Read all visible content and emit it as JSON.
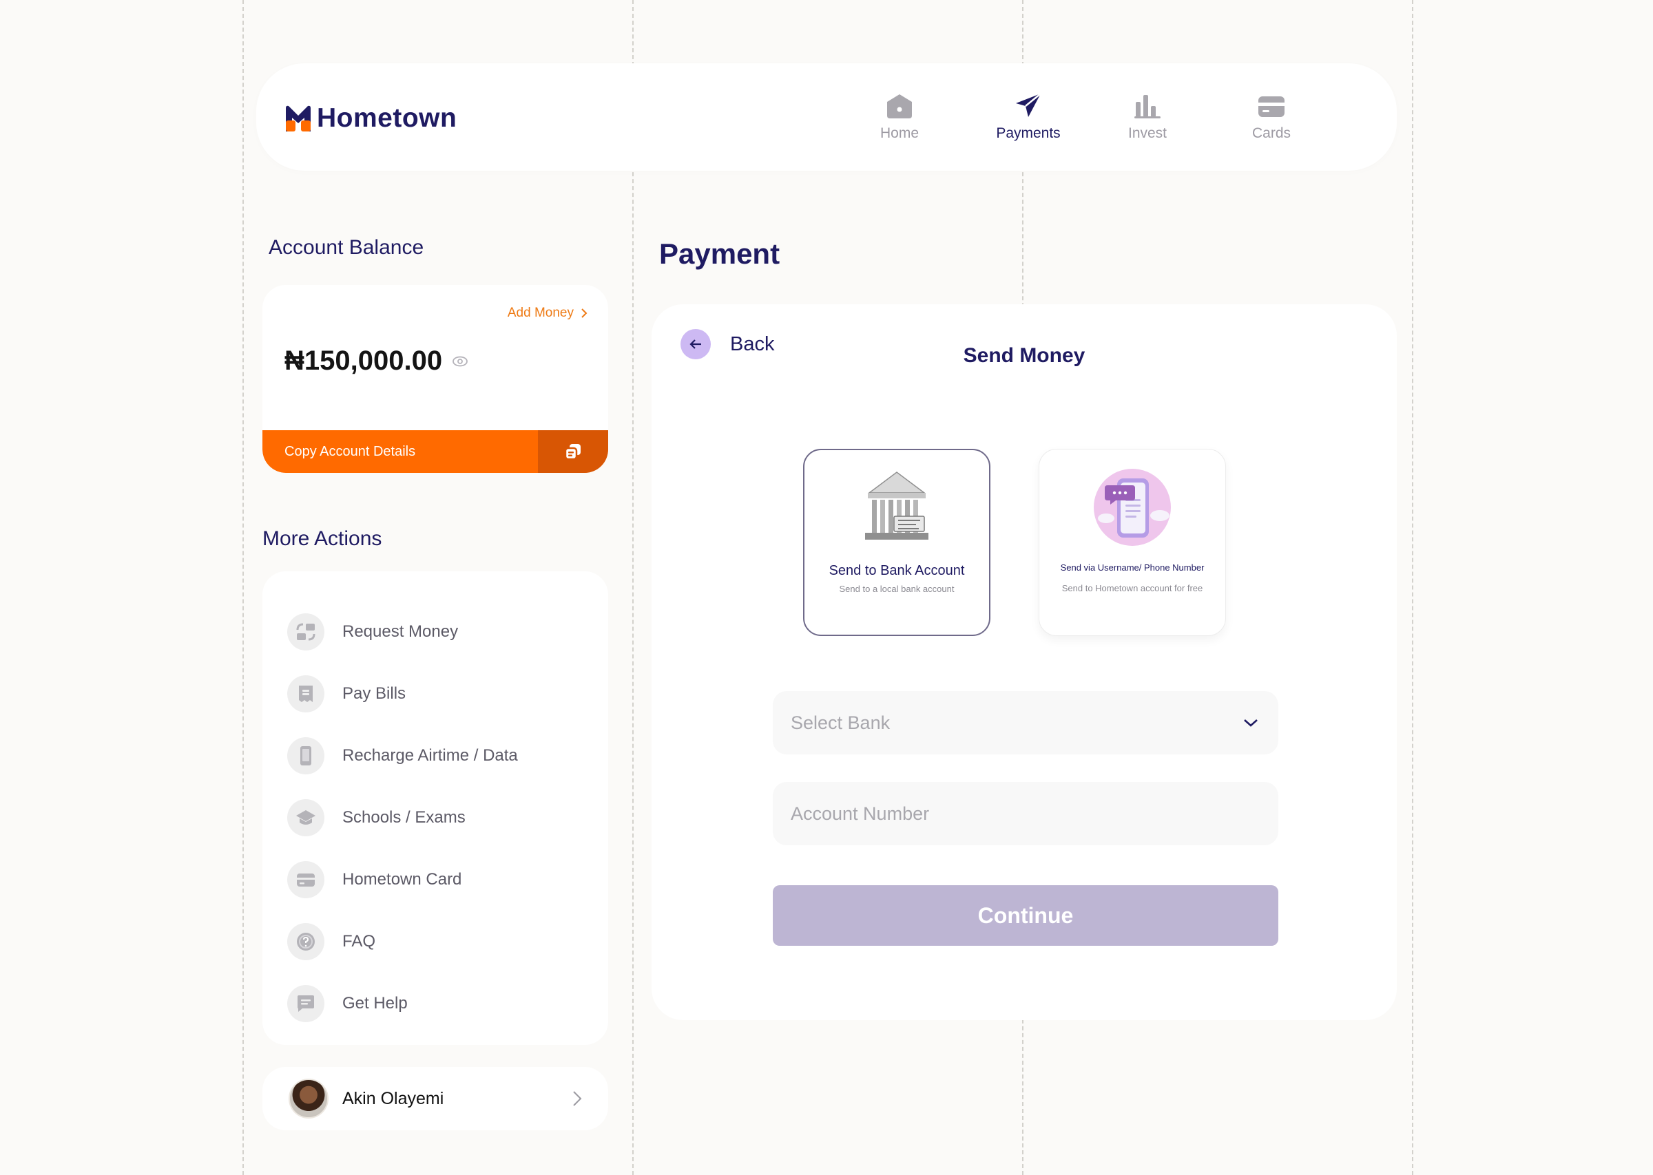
{
  "app": {
    "brand": "Hometown",
    "colors": {
      "primary": "#1f1b62",
      "accent": "#ff6a00",
      "muted": "#9d9aa3",
      "disabled_button": "#bdb5d3"
    }
  },
  "nav": {
    "items": [
      {
        "label": "Home",
        "icon": "home-icon",
        "active": false
      },
      {
        "label": "Payments",
        "icon": "paper-plane-icon",
        "active": true
      },
      {
        "label": "Invest",
        "icon": "bar-chart-icon",
        "active": false
      },
      {
        "label": "Cards",
        "icon": "card-icon",
        "active": false
      }
    ]
  },
  "balance": {
    "section_title": "Account Balance",
    "add_money_label": "Add Money",
    "amount": "₦150,000.00",
    "copy_label": "Copy Account Details"
  },
  "actions": {
    "section_title": "More Actions",
    "items": [
      {
        "label": "Request Money",
        "icon": "exchange-icon"
      },
      {
        "label": "Pay Bills",
        "icon": "receipt-icon"
      },
      {
        "label": "Recharge Airtime / Data",
        "icon": "phone-icon"
      },
      {
        "label": "Schools / Exams",
        "icon": "graduation-cap-icon"
      },
      {
        "label": "Hometown Card",
        "icon": "card-icon"
      },
      {
        "label": "FAQ",
        "icon": "question-icon"
      },
      {
        "label": "Get Help",
        "icon": "chat-icon"
      }
    ]
  },
  "profile": {
    "name": "Akin Olayemi"
  },
  "payment": {
    "page_title": "Payment",
    "back_label": "Back",
    "panel_title": "Send Money",
    "options": [
      {
        "title": "Send to Bank Account",
        "subtitle": "Send to a local bank account",
        "icon": "bank-building-icon",
        "selected": true
      },
      {
        "title": "Send via Username/ Phone Number",
        "subtitle": "Send to Hometown account for free",
        "icon": "phone-chat-icon",
        "selected": false
      }
    ],
    "bank_placeholder": "Select Bank",
    "account_placeholder": "Account Number",
    "continue_label": "Continue"
  }
}
